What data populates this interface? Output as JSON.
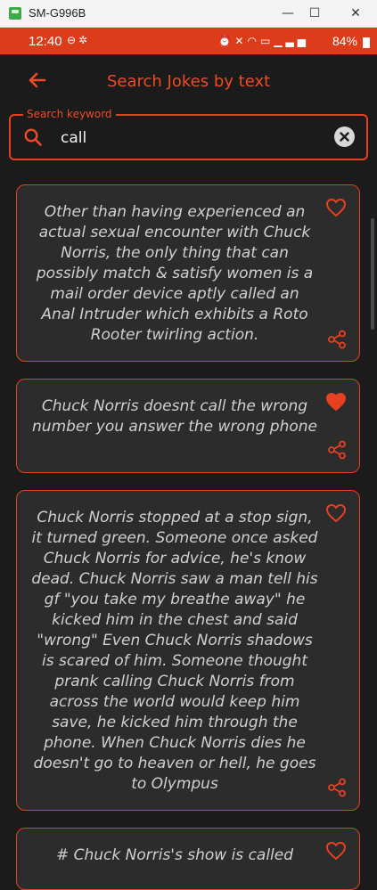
{
  "window": {
    "title": "SM-G996B",
    "minimize_glyph": "—",
    "maximize_glyph": "☐",
    "close_glyph": "✕"
  },
  "status_bar": {
    "time": "12:40",
    "battery_percent": "84%",
    "left_icons": [
      "notification-icon",
      "settings-icon"
    ],
    "right_icons": [
      "alarm-icon",
      "mute-icon",
      "wifi-icon",
      "volte-icon",
      "signal-icon"
    ]
  },
  "app_bar": {
    "title": "Search Jokes by text",
    "back_icon": "arrow-left-icon"
  },
  "search": {
    "label": "Search keyword",
    "value": "call",
    "icon": "search-icon",
    "clear_icon": "clear-icon"
  },
  "jokes": [
    {
      "text": "Other than having experienced an actual sexual encounter with Chuck Norris, the only thing that can possibly match & satisfy women is a mail order device aptly called an Anal Intruder which exhibits a Roto Rooter twirling action.",
      "favorite": false
    },
    {
      "text": "Chuck Norris doesnt call the wrong number you answer the wrong phone",
      "favorite": true
    },
    {
      "text": "Chuck Norris stopped at a stop sign, it turned green. Someone once asked Chuck Norris for advice, he's know dead. Chuck Norris saw a man tell his gf \"you take my breathe away\" he kicked him in the chest and said \"wrong\" Even Chuck Norris shadows is scared of him. Someone thought prank calling Chuck Norris from across the world would keep him save, he kicked him through the phone. When Chuck Norris dies he doesn't go to heaven or hell, he goes to Olympus",
      "favorite": false
    },
    {
      "text": "# Chuck Norris's show is called",
      "favorite": false
    }
  ],
  "colors": {
    "accent": "#e6401f",
    "status_bar": "#dd3c1b",
    "background": "#1b1b1b",
    "card": "#2c2c2c",
    "text": "#d0d0d0"
  }
}
